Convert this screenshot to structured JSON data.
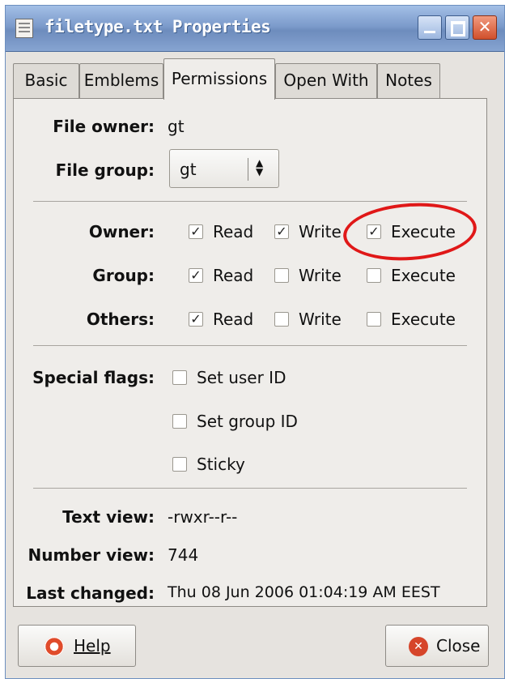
{
  "window": {
    "title": "filetype.txt Properties",
    "controls": {
      "minimize_icon": "minimize-icon",
      "maximize_icon": "maximize-icon",
      "close_icon": "close-icon"
    }
  },
  "tabs": [
    {
      "label": "Basic",
      "active": false
    },
    {
      "label": "Emblems",
      "active": false
    },
    {
      "label": "Permissions",
      "active": true
    },
    {
      "label": "Open With",
      "active": false
    },
    {
      "label": "Notes",
      "active": false
    }
  ],
  "owner_section": {
    "file_owner_label": "File owner:",
    "file_owner_value": "gt",
    "file_group_label": "File group:",
    "file_group_value": "gt"
  },
  "permissions": {
    "rows": [
      {
        "label": "Owner:",
        "read": true,
        "write": true,
        "execute": true
      },
      {
        "label": "Group:",
        "read": true,
        "write": false,
        "execute": false
      },
      {
        "label": "Others:",
        "read": true,
        "write": false,
        "execute": false
      }
    ],
    "read_label": "Read",
    "write_label": "Write",
    "execute_label": "Execute"
  },
  "special_flags": {
    "label": "Special flags:",
    "set_user_id": {
      "label": "Set user ID",
      "checked": false
    },
    "set_group_id": {
      "label": "Set group ID",
      "checked": false
    },
    "sticky": {
      "label": "Sticky",
      "checked": false
    }
  },
  "info": {
    "text_view_label": "Text view:",
    "text_view_value": "-rwxr--r--",
    "number_view_label": "Number view:",
    "number_view_value": "744",
    "last_changed_label": "Last changed:",
    "last_changed_value": "Thu 08 Jun 2006 01:04:19 AM EEST"
  },
  "buttons": {
    "help": {
      "label": "Help",
      "icon": "lifebuoy-icon"
    },
    "close": {
      "label": "Close",
      "icon": "close-circle-icon"
    }
  },
  "colors": {
    "highlight": "#e01818",
    "titlebar": "#7c9bcb"
  }
}
